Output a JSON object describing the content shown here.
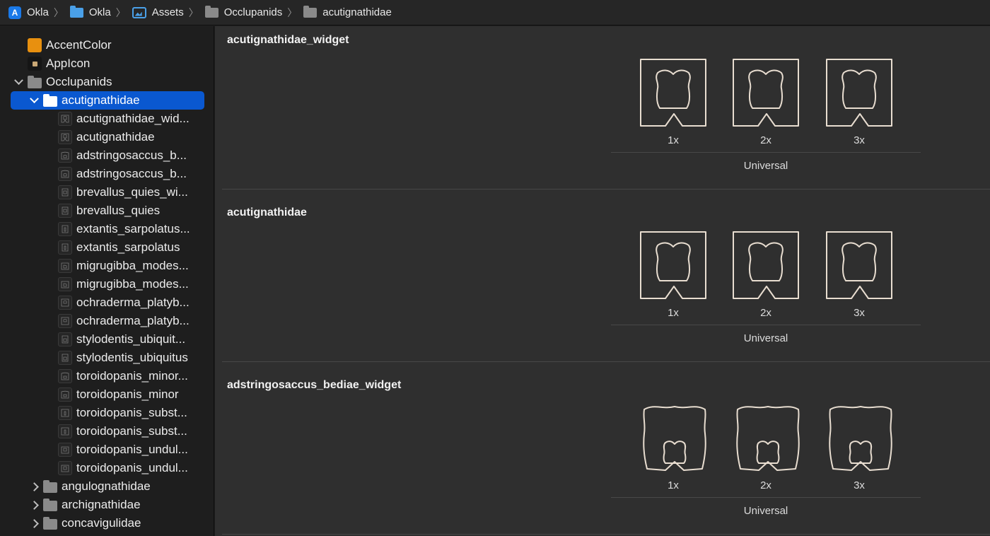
{
  "breadcrumb": [
    {
      "label": "Okla",
      "icon": "app-icon"
    },
    {
      "label": "Okla",
      "icon": "folder-blue-icon"
    },
    {
      "label": "Assets",
      "icon": "asset-catalog-icon"
    },
    {
      "label": "Occlupanids",
      "icon": "folder-gray-icon"
    },
    {
      "label": "acutignathidae",
      "icon": "folder-gray-icon"
    }
  ],
  "sidebar": {
    "items": [
      {
        "label": "AccentColor",
        "icon": "color-set-icon"
      },
      {
        "label": "AppIcon",
        "icon": "app-icon-set-icon"
      },
      {
        "label": "Occlupanids",
        "icon": "folder-icon",
        "expanded": true
      },
      {
        "label": "acutignathidae",
        "icon": "folder-icon",
        "expanded": true,
        "selected": true
      },
      {
        "label": "acutignathidae_wid..."
      },
      {
        "label": "acutignathidae"
      },
      {
        "label": "adstringosaccus_b..."
      },
      {
        "label": "adstringosaccus_b..."
      },
      {
        "label": "brevallus_quies_wi..."
      },
      {
        "label": "brevallus_quies"
      },
      {
        "label": "extantis_sarpolatus..."
      },
      {
        "label": "extantis_sarpolatus"
      },
      {
        "label": "migrugibba_modes..."
      },
      {
        "label": "migrugibba_modes..."
      },
      {
        "label": "ochraderma_platyb..."
      },
      {
        "label": "ochraderma_platyb..."
      },
      {
        "label": "stylodentis_ubiquit..."
      },
      {
        "label": "stylodentis_ubiquitus"
      },
      {
        "label": "toroidopanis_minor..."
      },
      {
        "label": "toroidopanis_minor"
      },
      {
        "label": "toroidopanis_subst..."
      },
      {
        "label": "toroidopanis_subst..."
      },
      {
        "label": "toroidopanis_undul..."
      },
      {
        "label": "toroidopanis_undul..."
      },
      {
        "label": "angulognathidae",
        "icon": "folder-icon",
        "expanded": false
      },
      {
        "label": "archignathidae",
        "icon": "folder-icon",
        "expanded": false
      },
      {
        "label": "concavigulidae",
        "icon": "folder-icon",
        "expanded": false
      }
    ]
  },
  "image_sets": [
    {
      "title": "acutignathidae_widget",
      "slots": [
        "1x",
        "2x",
        "3x"
      ],
      "idiom": "Universal"
    },
    {
      "title": "acutignathidae",
      "slots": [
        "1x",
        "2x",
        "3x"
      ],
      "idiom": "Universal"
    },
    {
      "title": "adstringosaccus_bediae_widget",
      "slots": [
        "1x",
        "2x",
        "3x"
      ],
      "idiom": "Universal"
    }
  ],
  "colors": {
    "selection": "#0a58d0",
    "accent_color_swatch": "#e8900f",
    "outline_stroke": "#e8ddd0"
  }
}
